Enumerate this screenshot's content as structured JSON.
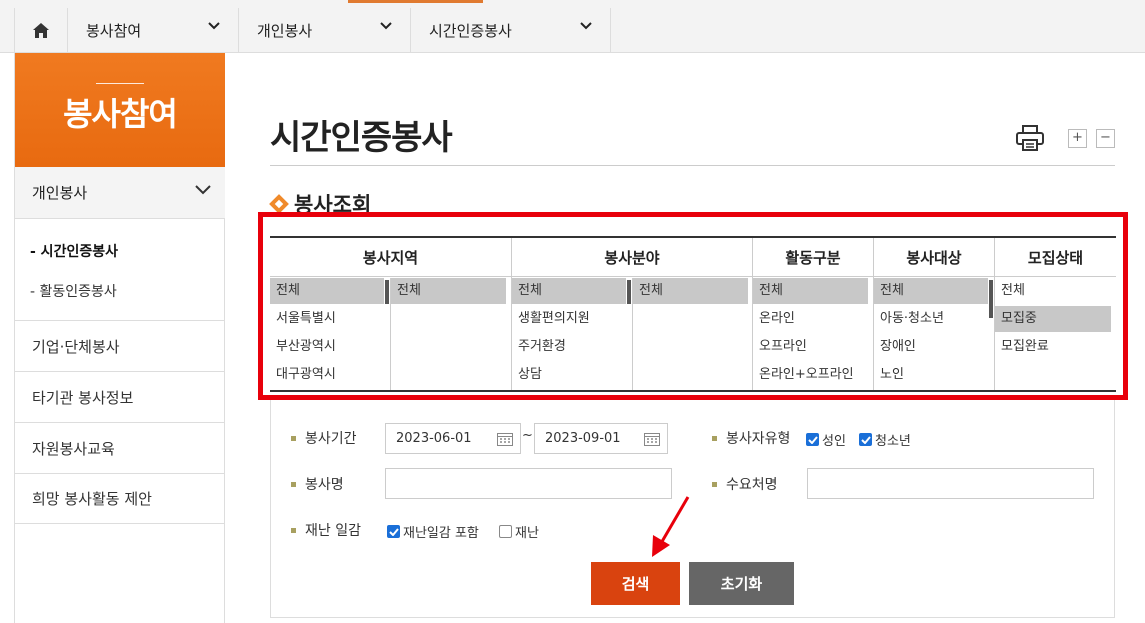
{
  "nav": {
    "home_icon": "home-icon",
    "crumbs": [
      "봉사참여",
      "개인봉사",
      "시간인증봉사"
    ],
    "accent_color": "#e07a30"
  },
  "sidebar": {
    "banner_title": "봉사참여",
    "banner_color": "#ee7418",
    "category": "개인봉사",
    "subitems": [
      "- 시간인증봉사",
      "- 활동인증봉사"
    ],
    "items": [
      "기업·단체봉사",
      "타기관 봉사정보",
      "자원봉사교육",
      "희망 봉사활동 제안"
    ]
  },
  "main": {
    "page_title": "시간인증봉사",
    "zoom_in": "+",
    "zoom_out": "−",
    "section_title": "봉사조회"
  },
  "filter": {
    "region": {
      "header": "봉사지역",
      "list1": [
        "전체",
        "서울특별시",
        "부산광역시",
        "대구광역시"
      ],
      "list2": [
        "전체"
      ]
    },
    "field": {
      "header": "봉사분야",
      "list1": [
        "전체",
        "생활편의지원",
        "주거환경",
        "상담"
      ],
      "list2": [
        "전체"
      ]
    },
    "activity": {
      "header": "활동구분",
      "list": [
        "전체",
        "온라인",
        "오프라인",
        "온라인+오프라인"
      ]
    },
    "target": {
      "header": "봉사대상",
      "list": [
        "전체",
        "아동·청소년",
        "장애인",
        "노인"
      ]
    },
    "status": {
      "header": "모집상태",
      "list": [
        "전체",
        "모집중",
        "모집완료"
      ],
      "selected": "모집중"
    }
  },
  "form": {
    "period_label": "봉사기간",
    "start_date": "2023-06-01",
    "tilde": "~",
    "end_date": "2023-09-01",
    "volunteer_type_label": "봉사자유형",
    "adult_label": "성인",
    "youth_label": "청소년",
    "name_label": "봉사명",
    "name_value": "",
    "demand_label": "수요처명",
    "demand_value": "",
    "disaster_label": "재난 일감",
    "disaster_include_label": "재난일감 포함",
    "disaster_only_label": "재난",
    "adult_checked": true,
    "youth_checked": true,
    "disaster_include_checked": true,
    "disaster_only_checked": false
  },
  "buttons": {
    "search": "검색",
    "reset": "초기화"
  },
  "colors": {
    "highlight_box": "#e8000b",
    "annotation_arrow": "#e8000b",
    "search_button": "#d9430f",
    "reset_button": "#666666"
  }
}
